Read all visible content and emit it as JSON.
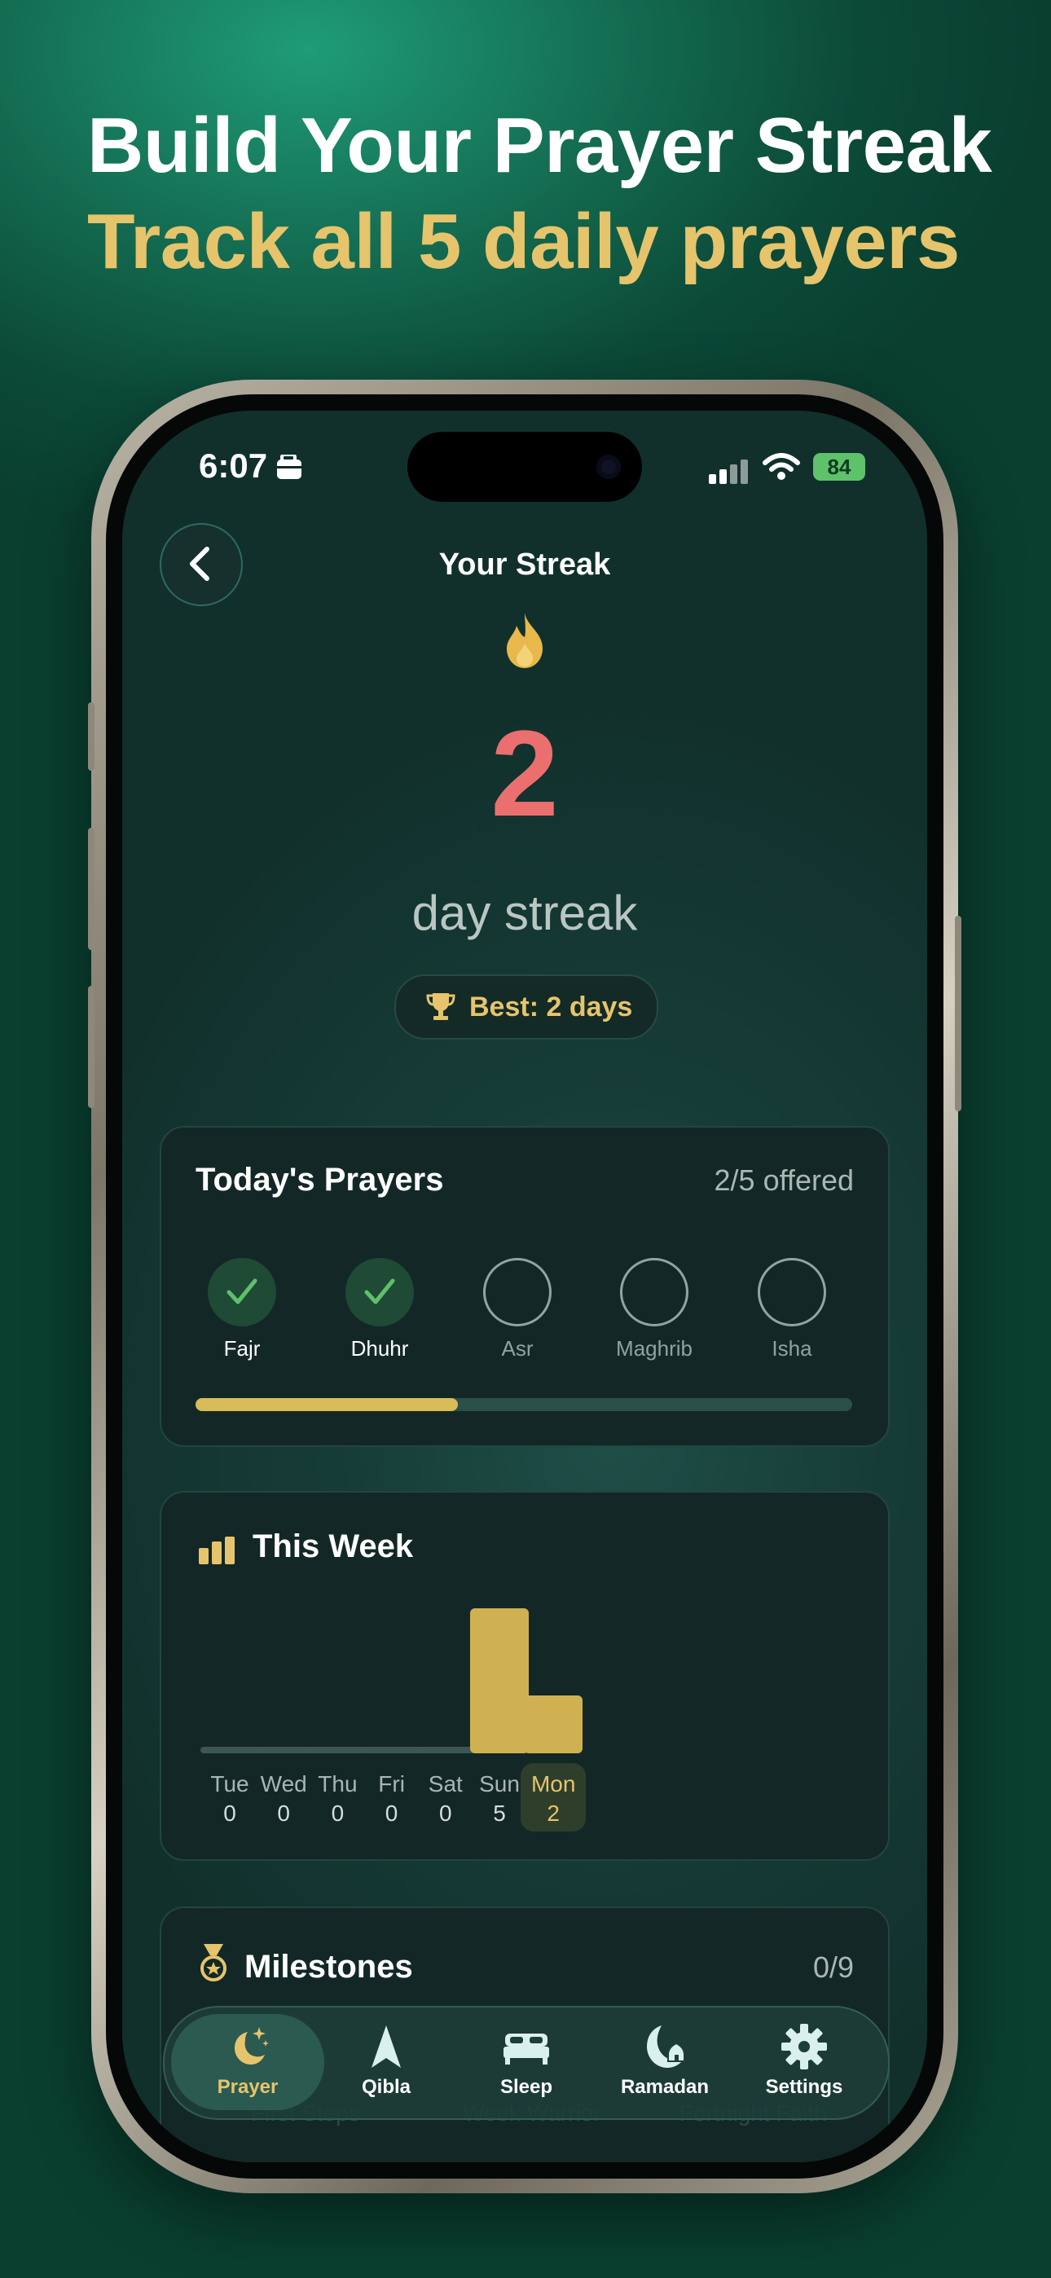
{
  "headline": {
    "line1": "Build Your Prayer Streak",
    "line2": "Track all 5 daily prayers"
  },
  "status_bar": {
    "time": "6:07",
    "battery": "84"
  },
  "screen": {
    "title": "Your Streak",
    "streak_count": "2",
    "streak_label": "day streak",
    "best": "Best: 2 days"
  },
  "today": {
    "title": "Today's Prayers",
    "summary": "2/5 offered",
    "progress_fraction": 0.4,
    "prayers": [
      {
        "name": "Fajr",
        "done": true
      },
      {
        "name": "Dhuhr",
        "done": true
      },
      {
        "name": "Asr",
        "done": false
      },
      {
        "name": "Maghrib",
        "done": false
      },
      {
        "name": "Isha",
        "done": false
      }
    ]
  },
  "week": {
    "title": "This Week"
  },
  "chart_data": {
    "type": "bar",
    "title": "This Week",
    "categories": [
      "Tue",
      "Wed",
      "Thu",
      "Fri",
      "Sat",
      "Sun",
      "Mon"
    ],
    "values": [
      0,
      0,
      0,
      0,
      0,
      5,
      2
    ],
    "ylim": [
      0,
      5
    ],
    "highlighted_category": "Mon",
    "colors": {
      "bar": "#d0b152",
      "empty": "#3c5753",
      "highlight_bg": "#2e3e2b"
    }
  },
  "milestones": {
    "title": "Milestones",
    "count": "0/9",
    "items": [
      "First Steps",
      "Week Warrior",
      "Fortnight Faith"
    ]
  },
  "nav": [
    {
      "label": "Prayer",
      "icon": "moon-stars-icon",
      "active": true
    },
    {
      "label": "Qibla",
      "icon": "compass-arrow-icon",
      "active": false
    },
    {
      "label": "Sleep",
      "icon": "bed-icon",
      "active": false
    },
    {
      "label": "Ramadan",
      "icon": "crescent-mosque-icon",
      "active": false
    },
    {
      "label": "Settings",
      "icon": "gear-icon",
      "active": false
    }
  ],
  "colors": {
    "accent_gold": "#e6c46c",
    "streak_red": "#ec6f6f",
    "check_green": "#5fbf6a"
  }
}
